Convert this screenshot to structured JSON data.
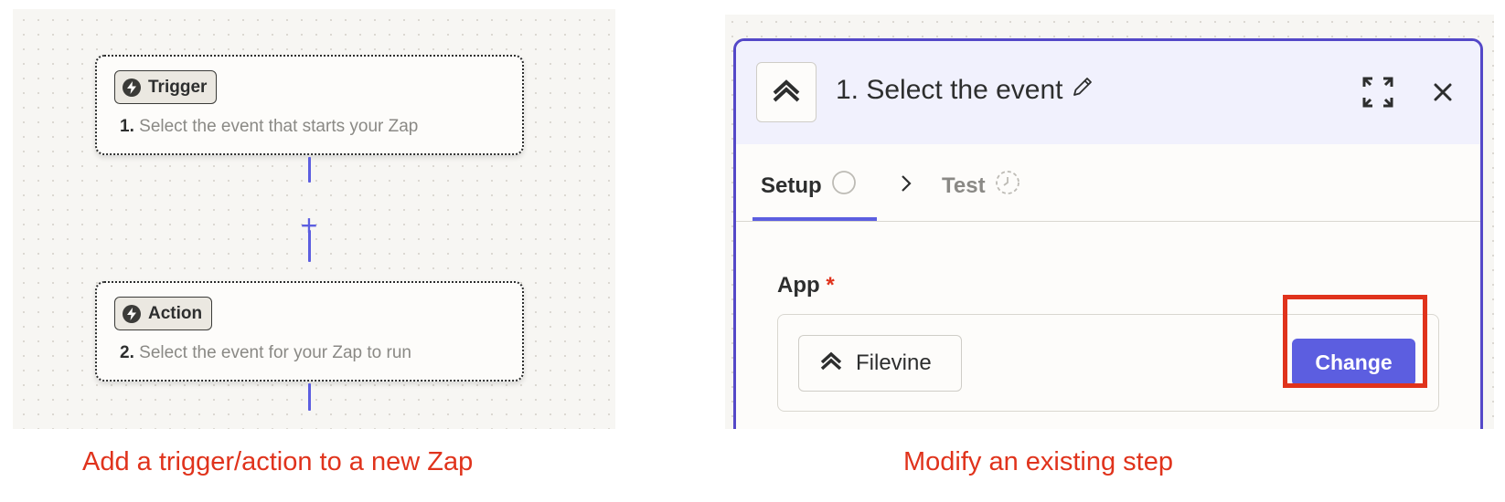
{
  "left": {
    "trigger": {
      "badge": "Trigger",
      "number": "1.",
      "description": "Select the event that starts your Zap"
    },
    "add_step": "+",
    "action": {
      "badge": "Action",
      "number": "2.",
      "description": "Select the event for your Zap to run"
    },
    "caption": "Add a trigger/action to a new Zap"
  },
  "right": {
    "editor": {
      "title": "1. Select the event",
      "tabs": [
        {
          "label": "Setup",
          "state": "active"
        },
        {
          "label": "Test",
          "state": "inactive"
        }
      ],
      "field": {
        "label": "App",
        "required_marker": "*"
      },
      "app": {
        "name": "Filevine",
        "change_label": "Change"
      }
    },
    "caption": "Modify an existing step"
  },
  "colors": {
    "accent": "#5c5ee0",
    "editor_border": "#5448c8",
    "header_bg": "#f1f1fd",
    "highlight": "#e0331c",
    "caption": "#e0331c"
  },
  "icons": [
    "bolt-icon",
    "filevine-logo-icon",
    "pencil-icon",
    "expand-icon",
    "close-icon",
    "circle-status-icon",
    "chevron-right-icon",
    "timer-icon"
  ]
}
